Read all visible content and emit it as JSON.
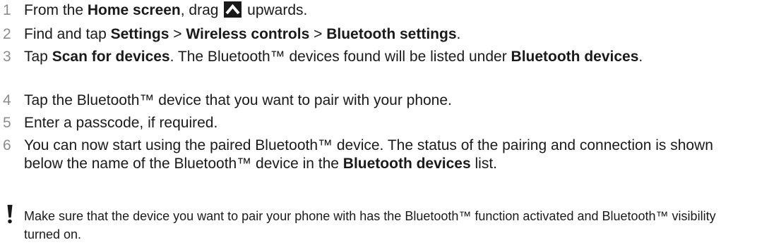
{
  "steps": [
    {
      "number": "1",
      "parts": {
        "a": "From the ",
        "b_home": "Home screen",
        "c": ", drag ",
        "d": " upwards."
      }
    },
    {
      "number": "2",
      "parts": {
        "a": "Find and tap ",
        "b_settings": "Settings",
        "c": " > ",
        "d_wireless": "Wireless controls",
        "e": " > ",
        "f_bt_settings": "Bluetooth settings",
        "g": "."
      }
    },
    {
      "number": "3",
      "parts": {
        "a": "Tap ",
        "b_scan": "Scan for devices",
        "c": ". The Bluetooth™ devices found will be listed under ",
        "d_bt_devices": "Bluetooth devices",
        "e": "."
      }
    },
    {
      "number": "4",
      "text": "Tap the Bluetooth™ device that you want to pair with your phone."
    },
    {
      "number": "5",
      "text": "Enter a passcode, if required."
    },
    {
      "number": "6",
      "parts": {
        "a": "You can now start using the paired Bluetooth™ device. The status of the pairing and connection is shown below the name of the Bluetooth™ device in the ",
        "b_bt_devices": "Bluetooth devices",
        "c": " list."
      }
    }
  ],
  "note": {
    "icon": "exclamation-icon",
    "text": "Make sure that the device you want to pair your phone with has the Bluetooth™ function activated and Bluetooth™ visibility turned on."
  },
  "icons": {
    "drag_up": "chevron-up-icon"
  },
  "colors": {
    "text": "#1a1a1a",
    "step_number": "#8c8c8c",
    "icon_bg": "#1a1a1a",
    "icon_fg": "#ffffff"
  }
}
